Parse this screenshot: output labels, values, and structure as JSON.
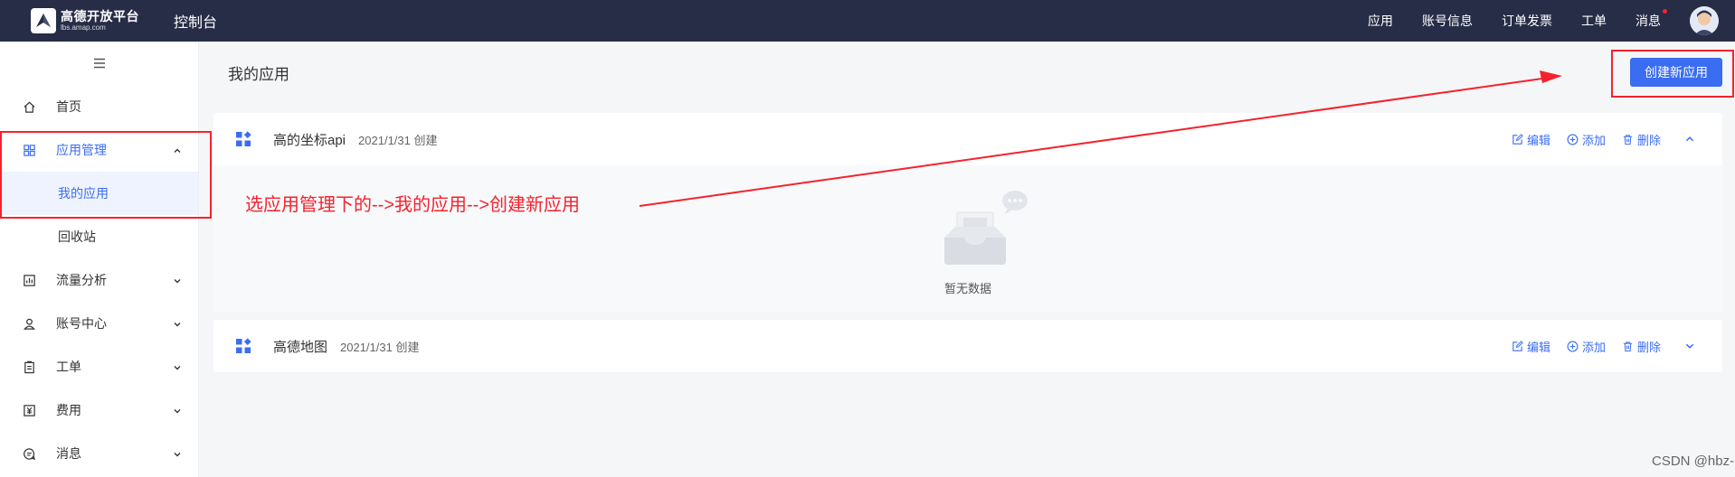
{
  "topbar": {
    "logo_title": "高德开放平台",
    "logo_sub": "lbs.amap.com",
    "console": "控制台",
    "nav": [
      "应用",
      "账号信息",
      "订单发票",
      "工单",
      "消息"
    ]
  },
  "sidebar": {
    "items": [
      {
        "label": "首页",
        "icon": "home-icon"
      },
      {
        "label": "应用管理",
        "icon": "grid-icon"
      },
      {
        "label": "流量分析",
        "icon": "chart-icon"
      },
      {
        "label": "账号中心",
        "icon": "user-icon"
      },
      {
        "label": "工单",
        "icon": "clipboard-icon"
      },
      {
        "label": "费用",
        "icon": "yuan-icon"
      },
      {
        "label": "消息",
        "icon": "message-icon"
      }
    ],
    "submenu": [
      "我的应用",
      "回收站"
    ]
  },
  "main": {
    "title": "我的应用",
    "create_button": "创建新应用",
    "apps": [
      {
        "name": "高的坐标api",
        "date": "2021/1/31 创建",
        "expanded": true
      },
      {
        "name": "高德地图",
        "date": "2021/1/31 创建",
        "expanded": false
      }
    ],
    "actions": {
      "edit": "编辑",
      "add": "添加",
      "delete": "删除"
    },
    "empty_text": "暂无数据"
  },
  "annotation": {
    "text": "选应用管理下的-->我的应用-->创建新应用",
    "color": "#f5222d"
  },
  "watermark": "CSDN @hbz-",
  "colors": {
    "accent": "#3b6df2",
    "topbar": "#272c47"
  }
}
